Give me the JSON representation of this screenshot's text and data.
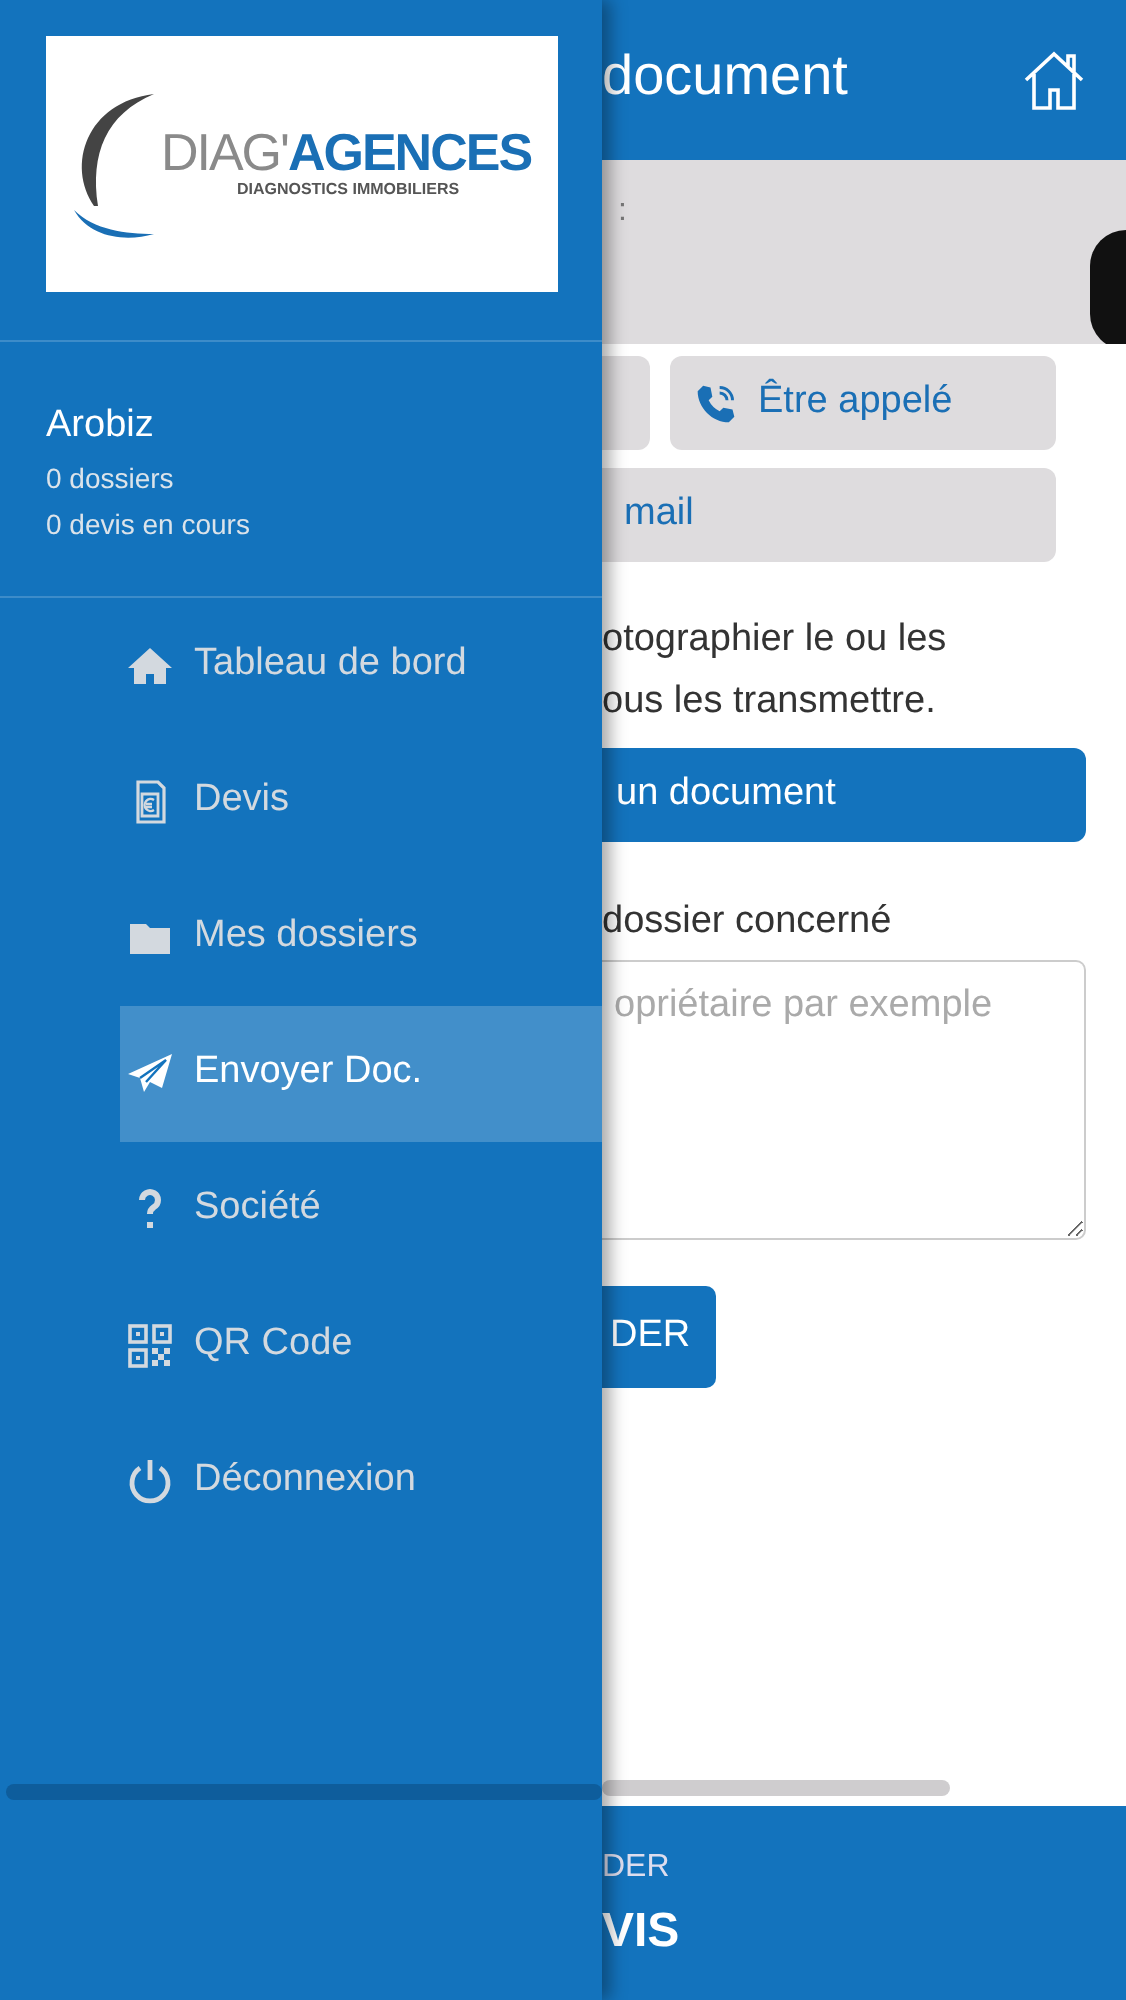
{
  "drawer": {
    "logo": {
      "light": "DIAG'",
      "bold": "AGENCES",
      "tagline": "DIAGNOSTICS IMMOBILIERS"
    },
    "user": {
      "name": "Arobiz",
      "stats": [
        "0 dossiers",
        "0 devis en cours"
      ]
    },
    "items": [
      {
        "label": "Tableau de bord",
        "selected": false
      },
      {
        "label": "Devis",
        "selected": false
      },
      {
        "label": "Mes dossiers",
        "selected": false
      },
      {
        "label": "Envoyer Doc.",
        "selected": true
      },
      {
        "label": "Société",
        "selected": false
      },
      {
        "label": "QR Code",
        "selected": false
      },
      {
        "label": "Déconnexion",
        "selected": false
      }
    ]
  },
  "page": {
    "title": "document",
    "banner_text": ":",
    "contact_buttons": [
      {
        "label": "Être appelé"
      }
    ],
    "mail_button": "mail",
    "instructions": [
      "otographier le ou les",
      "ous les transmettre."
    ],
    "upload_button": "un document",
    "field": {
      "label": "dossier concerné",
      "placeholder": "opriétaire par exemple"
    },
    "submit_button": "DER",
    "footer": {
      "small": "DER",
      "big": "VIS"
    }
  }
}
